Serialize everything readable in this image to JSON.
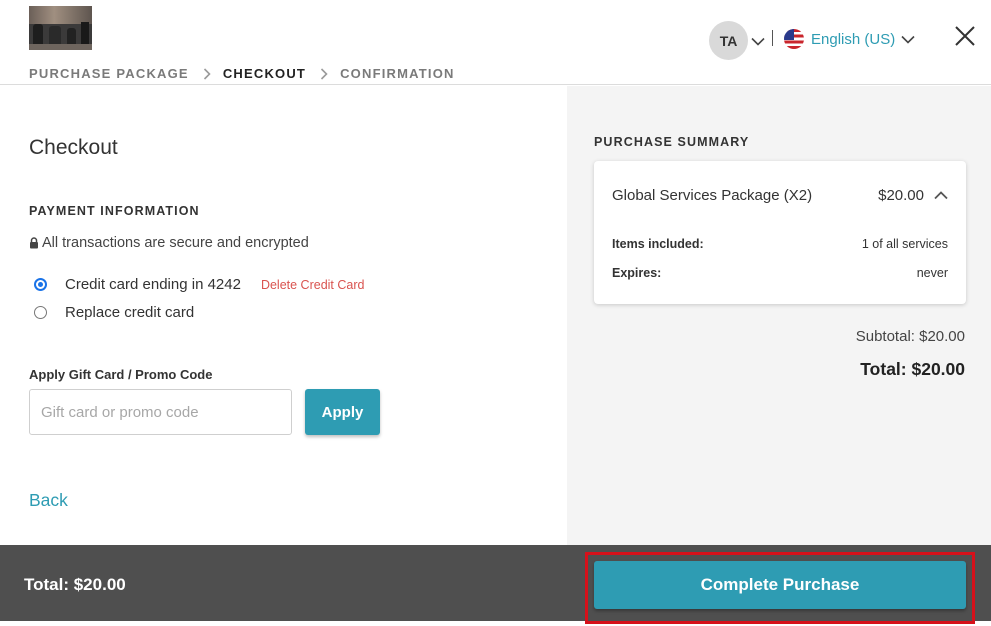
{
  "header": {
    "breadcrumb": [
      "PURCHASE PACKAGE",
      "CHECKOUT",
      "CONFIRMATION"
    ],
    "user_initials": "TA",
    "language": "English (US)",
    "icons": {
      "close": "close-icon",
      "chevron": "chevron-down-icon",
      "flag": "us-flag-icon"
    }
  },
  "checkout": {
    "title": "Checkout",
    "payment_label": "PAYMENT INFORMATION",
    "secure_note": "All transactions are secure and encrypted",
    "options": [
      {
        "label": "Credit card ending in 4242",
        "selected": true
      },
      {
        "label": "Replace credit card",
        "selected": false
      }
    ],
    "delete_card": "Delete Credit Card",
    "promo_label": "Apply Gift Card / Promo Code",
    "promo_placeholder": "Gift card or promo code",
    "promo_value": "",
    "apply": "Apply",
    "back": "Back"
  },
  "summary": {
    "label": "PURCHASE SUMMARY",
    "item_name": "Global Services Package (X2)",
    "item_price": "$20.00",
    "rows": [
      {
        "key": "Items included:",
        "value": "1 of all services"
      },
      {
        "key": "Expires:",
        "value": "never"
      }
    ],
    "subtotal": "Subtotal: $20.00",
    "total": "Total: $20.00"
  },
  "footer": {
    "total": "Total: $20.00",
    "complete": "Complete Purchase"
  },
  "colors": {
    "accent": "#2e9cb3",
    "danger": "#d9534f",
    "footer_bg": "#4f4f4f",
    "highlight": "#d6111a"
  }
}
